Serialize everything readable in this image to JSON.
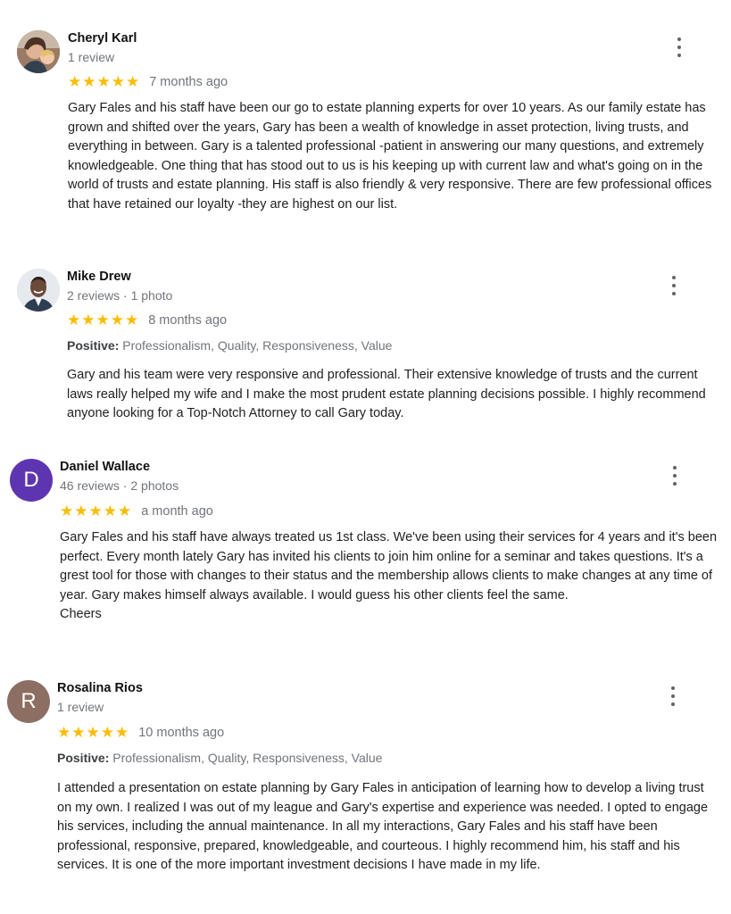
{
  "reviews": [
    {
      "name": "Cheryl Karl",
      "meta": "1 review",
      "stars": "★★★★★",
      "rating": 5,
      "when": "7 months ago",
      "avatar_color": "#8a6a5a",
      "text": "Gary Fales and his staff have been our go to estate planning experts for over 10 years. As our family estate has grown and shifted over the years, Gary has been a wealth of knowledge in asset protection, living trusts, and everything in between. Gary is a talented professional -patient in answering our many questions, and extremely knowledgeable. One thing that has stood out to us is his keeping up with current law and what's going on in the world of trusts and estate planning. His staff is also friendly & very responsive. There are few professional offices that have retained our loyalty -they are highest on our list."
    },
    {
      "name": "Mike Drew",
      "meta": "2 reviews · 1 photo",
      "stars": "★★★★★",
      "rating": 5,
      "when": "8 months ago",
      "positive_label": "Positive:",
      "positive_value": " Professionalism, Quality, Responsiveness, Value",
      "avatar_color": "#6b4a3a",
      "text": "Gary and his team were very responsive and professional. Their extensive knowledge of trusts and the current laws really helped my wife and I make the most prudent estate planning decisions possible. I highly recommend anyone looking for a Top-Notch Attorney to call Gary today."
    },
    {
      "name": "Daniel Wallace",
      "meta": "46 reviews · 2 photos",
      "stars": "★★★★★",
      "rating": 5,
      "when": "a month ago",
      "avatar_letter": "D",
      "avatar_color": "#5e35b1",
      "text": "Gary Fales and his staff have always treated us 1st class. We've been using their services for 4 years and it's been perfect. Every month lately Gary has invited his clients to join him online for a seminar and takes questions. It's a grest tool for those with changes to their status and the membership allows clients to make changes at any time of year. Gary makes himself always available. I would guess his other clients feel the same.",
      "text2": "Cheers"
    },
    {
      "name": "Rosalina Rios",
      "meta": "1 review",
      "stars": "★★★★★",
      "rating": 5,
      "when": "10 months ago",
      "positive_label": "Positive:",
      "positive_value": " Professionalism, Quality, Responsiveness, Value",
      "avatar_letter": "R",
      "avatar_color": "#8d6e63",
      "text": "I attended a presentation on estate planning by Gary Fales in anticipation of learning how to develop a living trust on my own. I realized I was out of my league and Gary's expertise and experience was needed. I opted to engage his services, including the annual maintenance. In all my interactions, Gary Fales and his staff have been professional, responsive, prepared, knowledgeable, and courteous. I highly recommend him, his staff and his services. It is one of the more important investment decisions I have made in my life."
    }
  ],
  "icons": {
    "more": "more-vert-icon",
    "star": "star-icon"
  }
}
